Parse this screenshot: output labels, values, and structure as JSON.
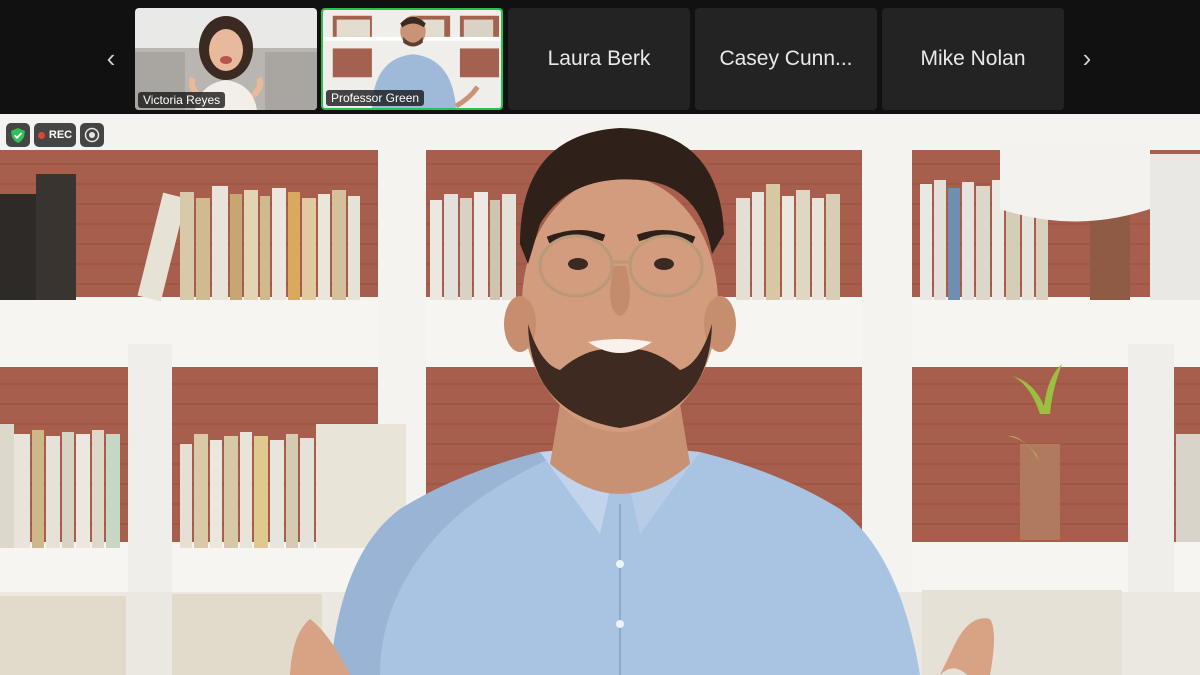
{
  "filmstrip": {
    "participants": [
      {
        "name": "Victoria Reyes",
        "has_video": true,
        "active": false
      },
      {
        "name": "Professor Green",
        "has_video": true,
        "active": true
      },
      {
        "name": "Laura Berk",
        "has_video": false,
        "active": false
      },
      {
        "name": "Casey Cunn...",
        "has_video": false,
        "active": false
      },
      {
        "name": "Mike Nolan",
        "has_video": false,
        "active": false
      }
    ],
    "prev_icon": "chevron-left-icon",
    "next_icon": "chevron-right-icon",
    "prev_glyph": "‹",
    "next_glyph": "›"
  },
  "status": {
    "rec_label": "REC",
    "shield_icon": "shield-check-icon",
    "camera_icon": "record-target-icon"
  },
  "main_video": {
    "speaker": "Professor Green"
  },
  "colors": {
    "active_border": "#23c552",
    "rec_dot": "#e5413c",
    "shield": "#2ec05a",
    "tile_bg": "#232323",
    "strip_bg": "#111111"
  }
}
